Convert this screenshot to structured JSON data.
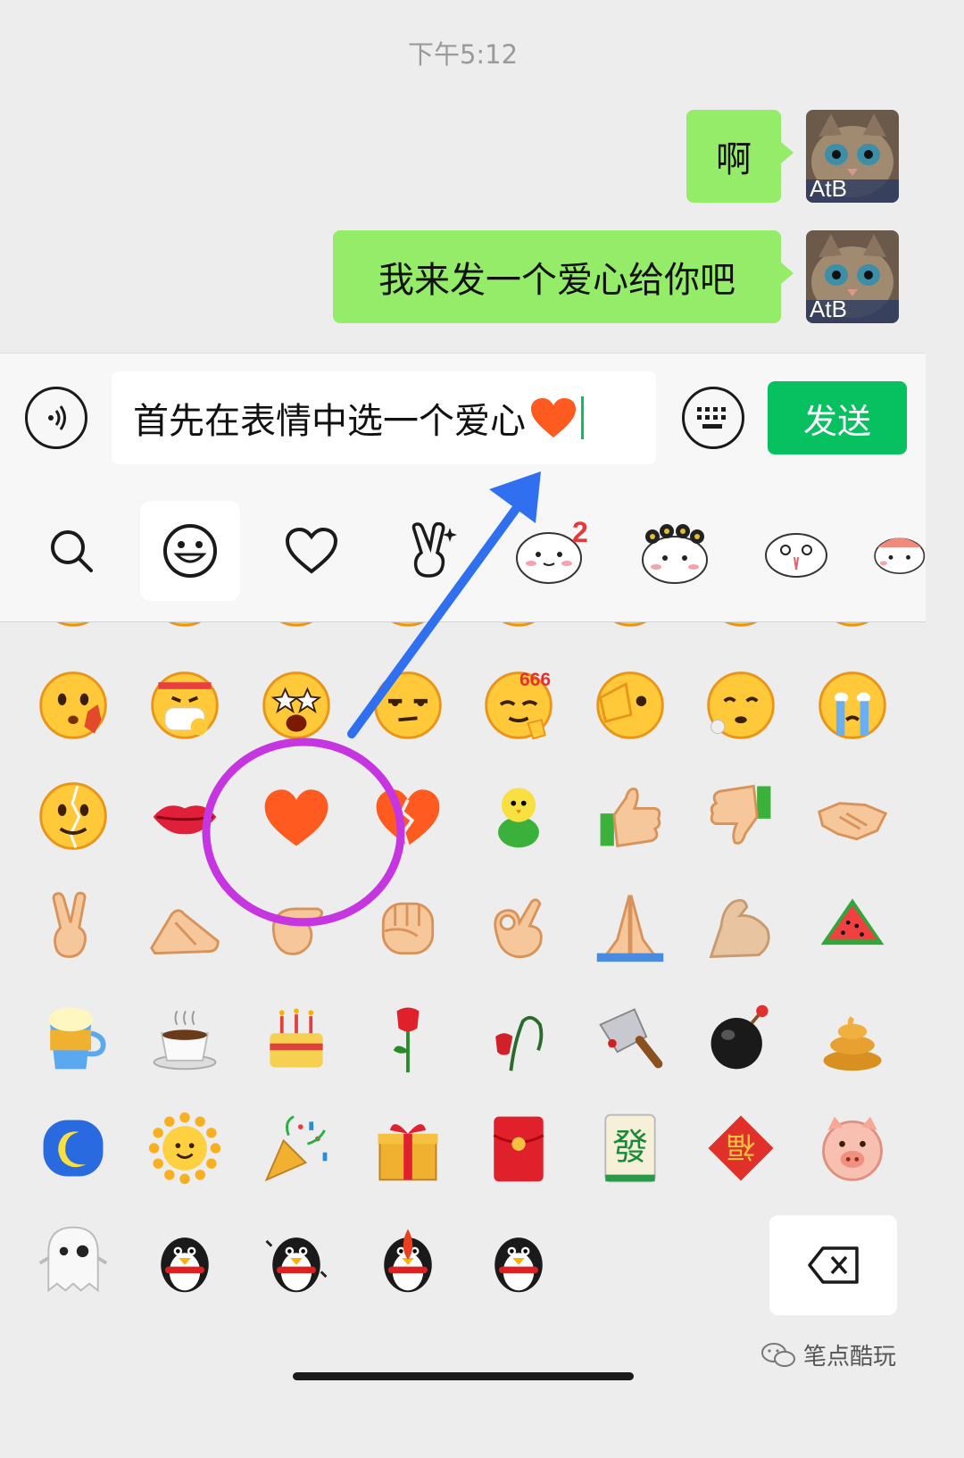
{
  "chat": {
    "timestamp": "下午5:12",
    "messages": [
      {
        "text": "啊",
        "avatar_label": "AtB"
      },
      {
        "text": "我来发一个爱心给你吧",
        "avatar_label": "AtB"
      }
    ]
  },
  "input": {
    "text": "首先在表情中选一个爱心",
    "inserted_emoji": "heart-emoji",
    "send_label": "发送"
  },
  "sticker_tabs": [
    {
      "icon": "search-icon"
    },
    {
      "icon": "smiley-icon",
      "active": true
    },
    {
      "icon": "heart-outline-icon"
    },
    {
      "icon": "victory-hand-icon"
    },
    {
      "icon": "sticker-pack-icon",
      "badge": "2"
    },
    {
      "icon": "sticker-pack-icon"
    },
    {
      "icon": "sticker-pack-icon"
    },
    {
      "icon": "sticker-pack-icon"
    }
  ],
  "emoji_grid": [
    [
      "flushed-hand-emoji",
      "mask-emoji",
      "starstruck-emoji",
      "smirk-emoji",
      "666-emoji",
      "facepalm-emoji",
      "sigh-emoji",
      "crying-emoji"
    ],
    [
      "cracked-face-emoji",
      "lips-emoji",
      "heart-emoji",
      "broken-heart-emoji",
      "green-chick-emoji",
      "thumbs-up-emoji",
      "thumbs-down-emoji",
      "handshake-emoji"
    ],
    [
      "victory-emoji",
      "fist-bump-emoji",
      "hook-hand-emoji",
      "fist-emoji",
      "ok-hand-emoji",
      "pray-emoji",
      "muscle-emoji",
      "watermelon-emoji"
    ],
    [
      "beer-emoji",
      "coffee-emoji",
      "cake-emoji",
      "rose-emoji",
      "wilted-rose-emoji",
      "cleaver-emoji",
      "bomb-emoji",
      "poop-emoji"
    ],
    [
      "moon-emoji",
      "sun-emoji",
      "party-popper-emoji",
      "gift-emoji",
      "red-packet-emoji",
      "mahjong-emoji",
      "fu-emoji",
      "pig-emoji"
    ],
    [
      "ghost-emoji",
      "penguin-emoji",
      "penguin-dance-emoji",
      "penguin-fire-emoji",
      "penguin-scarf-emoji"
    ]
  ],
  "badge_666": "666",
  "mahjong_char": "發",
  "fu_char": "福",
  "watermark": "笔点酷玩",
  "colors": {
    "bubble": "#95ec69",
    "send": "#07c160",
    "annotation_circle": "#c535e0",
    "annotation_arrow": "#2f6ff0",
    "heart": "#ff5a1f"
  }
}
